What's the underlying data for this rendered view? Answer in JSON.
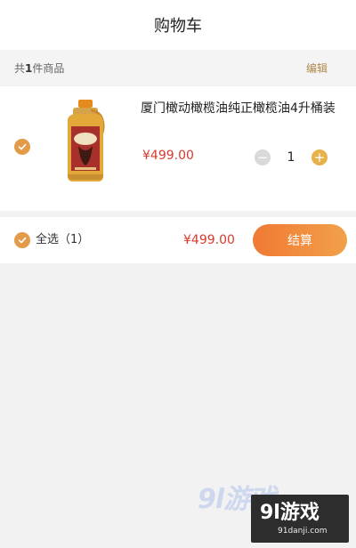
{
  "header": {
    "title": "购物车"
  },
  "subbar": {
    "prefix": "共",
    "count": "1",
    "suffix": "件商品",
    "edit_label": "编辑"
  },
  "cart": {
    "items": [
      {
        "name": "厦门橄动橄榄油纯正橄榄油4升桶装",
        "price": "¥499.00",
        "quantity": "1",
        "minus_label": "−",
        "plus_label": "+"
      }
    ]
  },
  "footer": {
    "select_all_label": "全选（1）",
    "total": "¥499.00",
    "checkout_label": "结算"
  },
  "watermark": {
    "logo": "9l游戏",
    "main": "9l游戏",
    "url": "91danji.com"
  },
  "colors": {
    "accent": "#e39b4a",
    "price": "#d83a2b",
    "edit": "#b0894b",
    "checkout_from": "#f07a33",
    "checkout_to": "#f2a04a"
  }
}
